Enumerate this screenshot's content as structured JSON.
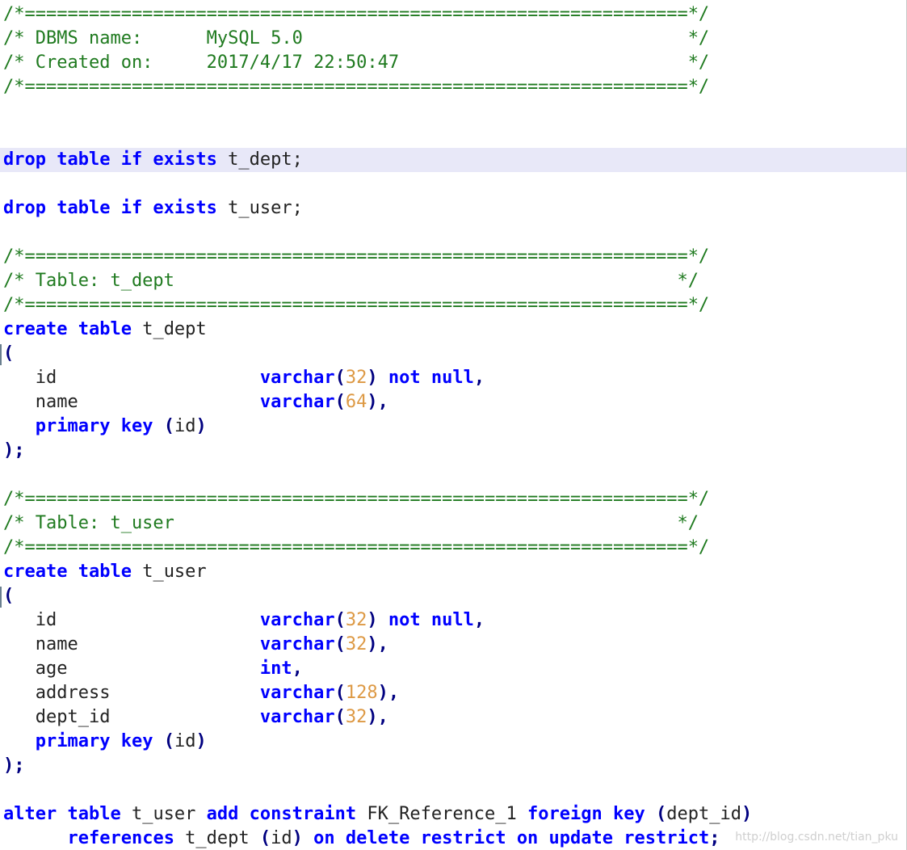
{
  "editor": {
    "language": "sql",
    "current_line_index": 6,
    "colors": {
      "keyword": "#0000ff",
      "comment": "#1f7a1f",
      "number": "#dd9944",
      "text": "#222222",
      "current_line_bg": "#e8e8f8"
    },
    "lines": [
      [
        {
          "t": "c",
          "v": "/*==============================================================*/"
        }
      ],
      [
        {
          "t": "c",
          "v": "/* DBMS name:      MySQL 5.0                                    */"
        }
      ],
      [
        {
          "t": "c",
          "v": "/* Created on:     2017/4/17 22:50:47                           */"
        }
      ],
      [
        {
          "t": "c",
          "v": "/*==============================================================*/"
        }
      ],
      [],
      [],
      [
        {
          "t": "k",
          "v": "drop table if exists"
        },
        {
          "t": "p",
          "v": " t_dept;"
        }
      ],
      [],
      [
        {
          "t": "k",
          "v": "drop table if exists"
        },
        {
          "t": "p",
          "v": " t_user;"
        }
      ],
      [],
      [
        {
          "t": "c",
          "v": "/*==============================================================*/"
        }
      ],
      [
        {
          "t": "c",
          "v": "/* Table: t_dept                                               */"
        }
      ],
      [
        {
          "t": "c",
          "v": "/*==============================================================*/"
        }
      ],
      [
        {
          "t": "k",
          "v": "create table"
        },
        {
          "t": "p",
          "v": " t_dept"
        }
      ],
      [
        {
          "t": "o",
          "v": "("
        }
      ],
      [
        {
          "t": "p",
          "v": "   id                   "
        },
        {
          "t": "k",
          "v": "varchar"
        },
        {
          "t": "o",
          "v": "("
        },
        {
          "t": "n",
          "v": "32"
        },
        {
          "t": "o",
          "v": ")"
        },
        {
          "t": "p",
          "v": " "
        },
        {
          "t": "k",
          "v": "not null"
        },
        {
          "t": "o",
          "v": ","
        }
      ],
      [
        {
          "t": "p",
          "v": "   name                 "
        },
        {
          "t": "k",
          "v": "varchar"
        },
        {
          "t": "o",
          "v": "("
        },
        {
          "t": "n",
          "v": "64"
        },
        {
          "t": "o",
          "v": "),"
        }
      ],
      [
        {
          "t": "p",
          "v": "   "
        },
        {
          "t": "k",
          "v": "primary key"
        },
        {
          "t": "p",
          "v": " "
        },
        {
          "t": "o",
          "v": "("
        },
        {
          "t": "p",
          "v": "id"
        },
        {
          "t": "o",
          "v": ")"
        }
      ],
      [
        {
          "t": "o",
          "v": ");"
        }
      ],
      [],
      [
        {
          "t": "c",
          "v": "/*==============================================================*/"
        }
      ],
      [
        {
          "t": "c",
          "v": "/* Table: t_user                                               */"
        }
      ],
      [
        {
          "t": "c",
          "v": "/*==============================================================*/"
        }
      ],
      [
        {
          "t": "k",
          "v": "create table"
        },
        {
          "t": "p",
          "v": " t_user"
        }
      ],
      [
        {
          "t": "o",
          "v": "("
        }
      ],
      [
        {
          "t": "p",
          "v": "   id                   "
        },
        {
          "t": "k",
          "v": "varchar"
        },
        {
          "t": "o",
          "v": "("
        },
        {
          "t": "n",
          "v": "32"
        },
        {
          "t": "o",
          "v": ")"
        },
        {
          "t": "p",
          "v": " "
        },
        {
          "t": "k",
          "v": "not null"
        },
        {
          "t": "o",
          "v": ","
        }
      ],
      [
        {
          "t": "p",
          "v": "   name                 "
        },
        {
          "t": "k",
          "v": "varchar"
        },
        {
          "t": "o",
          "v": "("
        },
        {
          "t": "n",
          "v": "32"
        },
        {
          "t": "o",
          "v": "),"
        }
      ],
      [
        {
          "t": "p",
          "v": "   age                  "
        },
        {
          "t": "k",
          "v": "int"
        },
        {
          "t": "o",
          "v": ","
        }
      ],
      [
        {
          "t": "p",
          "v": "   address              "
        },
        {
          "t": "k",
          "v": "varchar"
        },
        {
          "t": "o",
          "v": "("
        },
        {
          "t": "n",
          "v": "128"
        },
        {
          "t": "o",
          "v": "),"
        }
      ],
      [
        {
          "t": "p",
          "v": "   dept_id              "
        },
        {
          "t": "k",
          "v": "varchar"
        },
        {
          "t": "o",
          "v": "("
        },
        {
          "t": "n",
          "v": "32"
        },
        {
          "t": "o",
          "v": "),"
        }
      ],
      [
        {
          "t": "p",
          "v": "   "
        },
        {
          "t": "k",
          "v": "primary key"
        },
        {
          "t": "p",
          "v": " "
        },
        {
          "t": "o",
          "v": "("
        },
        {
          "t": "p",
          "v": "id"
        },
        {
          "t": "o",
          "v": ")"
        }
      ],
      [
        {
          "t": "o",
          "v": ");"
        }
      ],
      [],
      [
        {
          "t": "k",
          "v": "alter table"
        },
        {
          "t": "p",
          "v": " t_user "
        },
        {
          "t": "k",
          "v": "add constraint"
        },
        {
          "t": "p",
          "v": " FK_Reference_1 "
        },
        {
          "t": "k",
          "v": "foreign key"
        },
        {
          "t": "p",
          "v": " "
        },
        {
          "t": "o",
          "v": "("
        },
        {
          "t": "p",
          "v": "dept_id"
        },
        {
          "t": "o",
          "v": ")"
        }
      ],
      [
        {
          "t": "p",
          "v": "      "
        },
        {
          "t": "k",
          "v": "references"
        },
        {
          "t": "p",
          "v": " t_dept "
        },
        {
          "t": "o",
          "v": "("
        },
        {
          "t": "p",
          "v": "id"
        },
        {
          "t": "o",
          "v": ")"
        },
        {
          "t": "p",
          "v": " "
        },
        {
          "t": "k",
          "v": "on delete restrict on update restrict"
        },
        {
          "t": "o",
          "v": ";"
        }
      ]
    ],
    "watermark": "http://blog.csdn.net/tian_pku"
  }
}
